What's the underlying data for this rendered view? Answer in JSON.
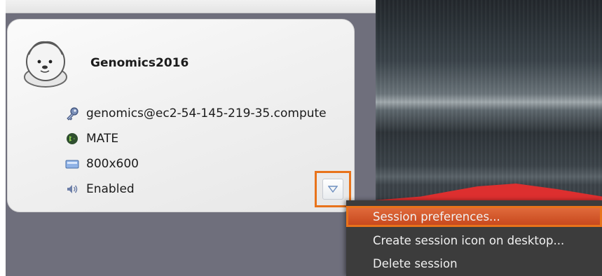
{
  "session": {
    "name": "Genomics2016",
    "server": "genomics@ec2-54-145-219-35.compute",
    "desktop": "MATE",
    "resolution": "800x600",
    "sound": "Enabled"
  },
  "context_menu": {
    "items": [
      {
        "label": "Session preferences..."
      },
      {
        "label": "Create session icon on desktop..."
      },
      {
        "label": "Delete session"
      }
    ]
  },
  "colors": {
    "highlight": "#e8731b",
    "menu_background": "#3c3c3c",
    "pane_background": "#6f6f7c"
  },
  "icons": [
    "avatar-seal",
    "key-icon",
    "mate-icon",
    "display-icon",
    "sound-icon",
    "dropdown-arrow-icon"
  ]
}
